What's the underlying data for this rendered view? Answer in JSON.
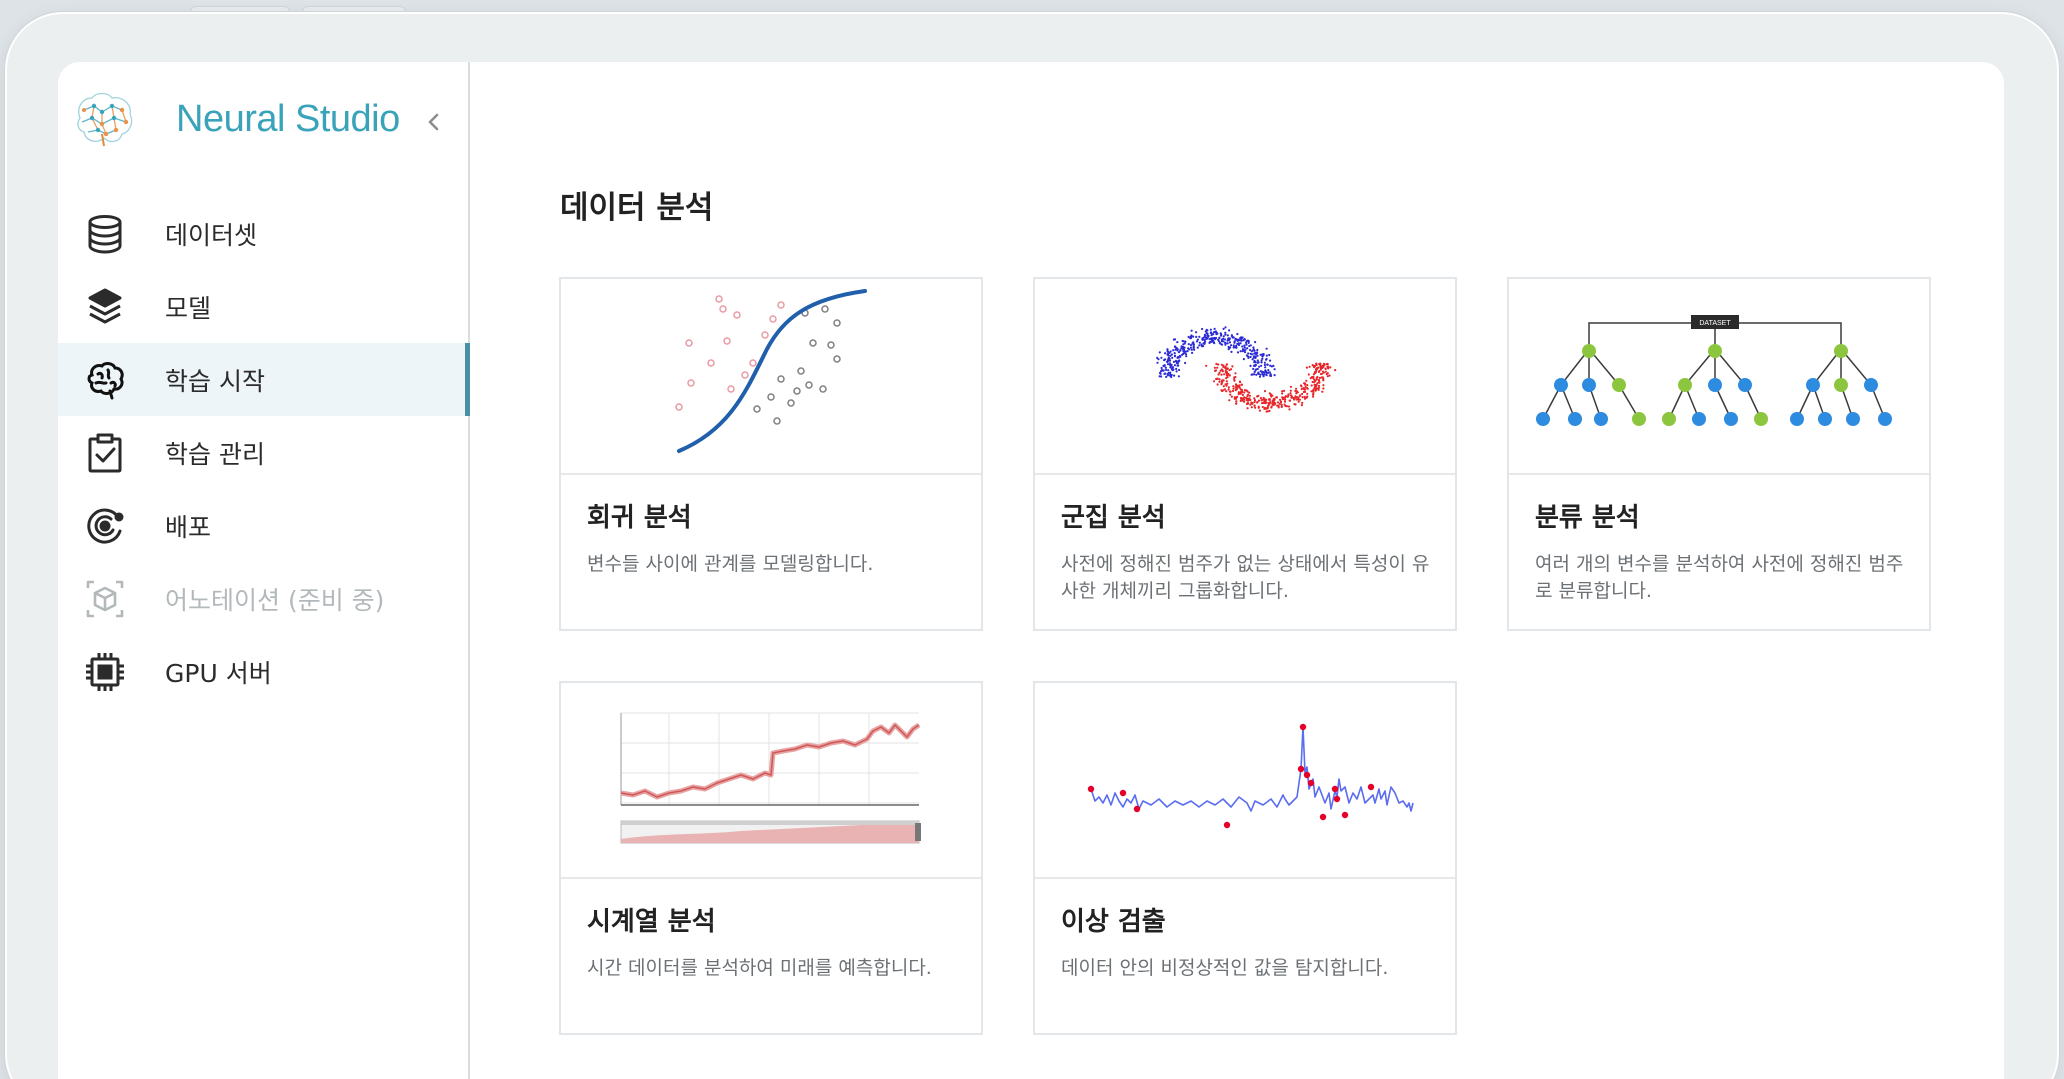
{
  "brand": {
    "name": "Neural Studio",
    "logo_icon": "brain-network-logo",
    "collapse_icon": "chevron-left-icon"
  },
  "colors": {
    "brand": "#3aa3ba",
    "active_bar": "#4a8fa5",
    "active_bg": "#eef5f8",
    "text": "#2b2b2b",
    "disabled": "#b3b8bb"
  },
  "nav": {
    "items": [
      {
        "label": "데이터셋",
        "icon": "database-icon",
        "active": false,
        "disabled": false
      },
      {
        "label": "모델",
        "icon": "layers-icon",
        "active": false,
        "disabled": false
      },
      {
        "label": "학습 시작",
        "icon": "brain-icon",
        "active": true,
        "disabled": false
      },
      {
        "label": "학습 관리",
        "icon": "clipboard-check-icon",
        "active": false,
        "disabled": false
      },
      {
        "label": "배포",
        "icon": "deploy-orbit-icon",
        "active": false,
        "disabled": false
      },
      {
        "label": "어노테이션 (준비 중)",
        "icon": "annotation-cube-icon",
        "active": false,
        "disabled": true
      },
      {
        "label": "GPU 서버",
        "icon": "chip-icon",
        "active": false,
        "disabled": false
      }
    ]
  },
  "main": {
    "title": "데이터 분석",
    "cards": [
      {
        "title": "회귀 분석",
        "desc": "변수들 사이에 관계를 모델링합니다.",
        "thumb": "regression-illustration"
      },
      {
        "title": "군집 분석",
        "desc": "사전에 정해진 범주가 없는 상태에서 특성이 유사한 개체끼리 그룹화합니다.",
        "thumb": "clustering-illustration"
      },
      {
        "title": "분류 분석",
        "desc": "여러 개의 변수를 분석하여 사전에 정해진 범주로 분류합니다.",
        "thumb": "classification-tree-illustration",
        "thumb_label": "DATASET"
      },
      {
        "title": "시계열 분석",
        "desc": "시간 데이터를 분석하여 미래를 예측합니다.",
        "thumb": "timeseries-illustration"
      },
      {
        "title": "이상 검출",
        "desc": "데이터 안의 비정상적인 값을 탐지합니다.",
        "thumb": "anomaly-illustration"
      }
    ]
  }
}
